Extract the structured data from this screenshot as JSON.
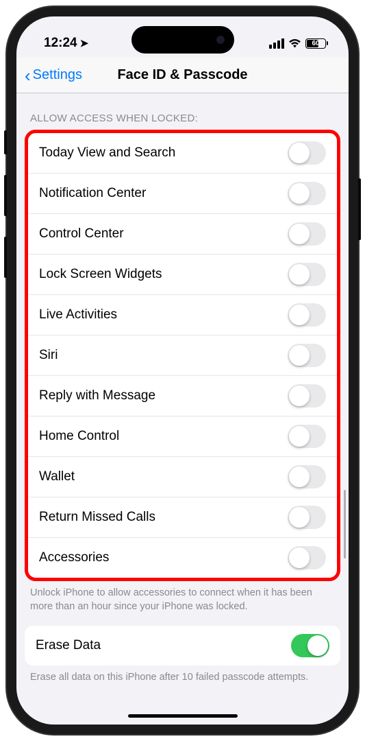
{
  "statusbar": {
    "time": "12:24",
    "battery_pct": "60"
  },
  "nav": {
    "back_label": "Settings",
    "title": "Face ID & Passcode"
  },
  "sections": {
    "allow_access": {
      "header": "ALLOW ACCESS WHEN LOCKED:",
      "items": [
        {
          "label": "Today View and Search",
          "on": false
        },
        {
          "label": "Notification Center",
          "on": false
        },
        {
          "label": "Control Center",
          "on": false
        },
        {
          "label": "Lock Screen Widgets",
          "on": false
        },
        {
          "label": "Live Activities",
          "on": false
        },
        {
          "label": "Siri",
          "on": false
        },
        {
          "label": "Reply with Message",
          "on": false
        },
        {
          "label": "Home Control",
          "on": false
        },
        {
          "label": "Wallet",
          "on": false
        },
        {
          "label": "Return Missed Calls",
          "on": false
        },
        {
          "label": "Accessories",
          "on": false
        }
      ],
      "footer": "Unlock iPhone to allow accessories to connect when it has been more than an hour since your iPhone was locked."
    },
    "erase": {
      "label": "Erase Data",
      "on": true,
      "footer": "Erase all data on this iPhone after 10 failed passcode attempts."
    }
  }
}
